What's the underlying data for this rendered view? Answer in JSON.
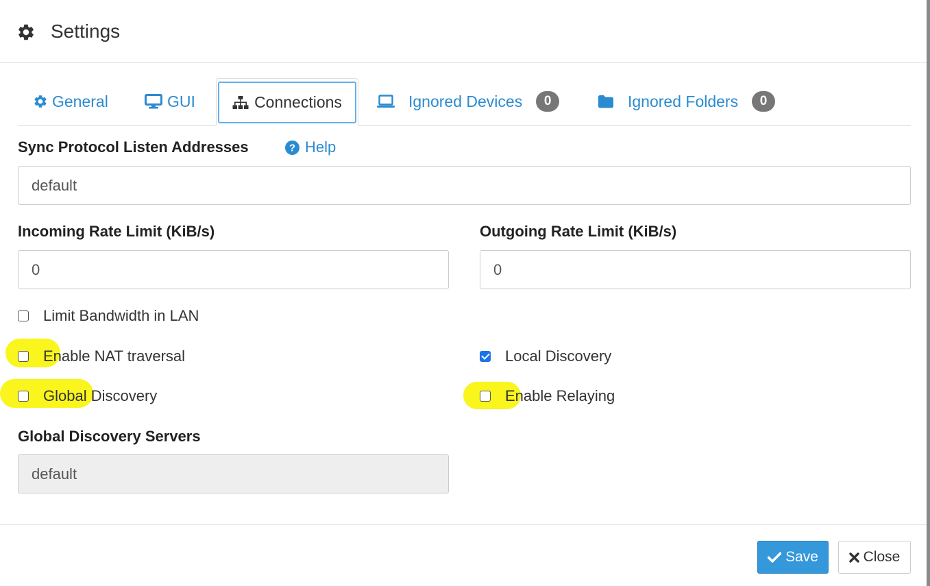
{
  "dialog": {
    "title": "Settings",
    "title_icon": "gear-icon"
  },
  "tabs": [
    {
      "label": "General",
      "icon": "gear-icon",
      "active": false
    },
    {
      "label": "GUI",
      "icon": "monitor-icon",
      "active": false
    },
    {
      "label": "Connections",
      "icon": "sitemap-icon",
      "active": true
    },
    {
      "label": "Ignored Devices",
      "icon": "laptop-icon",
      "badge": "0",
      "active": false
    },
    {
      "label": "Ignored Folders",
      "icon": "folder-icon",
      "badge": "0",
      "active": false
    }
  ],
  "connections": {
    "listen_addresses": {
      "label": "Sync Protocol Listen Addresses",
      "help": "Help",
      "value": "default"
    },
    "incoming_rate": {
      "label": "Incoming Rate Limit (KiB/s)",
      "value": "0"
    },
    "outgoing_rate": {
      "label": "Outgoing Rate Limit (KiB/s)",
      "value": "0"
    },
    "checkboxes": {
      "limit_bandwidth_lan": {
        "label": "Limit Bandwidth in LAN",
        "checked": false
      },
      "nat_traversal": {
        "label": "Enable NAT traversal",
        "checked": false
      },
      "local_discovery": {
        "label": "Local Discovery",
        "checked": true
      },
      "global_discovery": {
        "label": "Global Discovery",
        "checked": false
      },
      "enable_relaying": {
        "label": "Enable Relaying",
        "checked": false
      }
    },
    "global_discovery_servers": {
      "label": "Global Discovery Servers",
      "value": "default",
      "disabled": true
    }
  },
  "footer": {
    "save_label": "Save",
    "close_label": "Close"
  },
  "colors": {
    "highlight": "#f8f40a",
    "link": "#2a8bd0",
    "primary": "#3498db",
    "badge": "#777777",
    "checkbox_checked": "#1a73e8"
  }
}
